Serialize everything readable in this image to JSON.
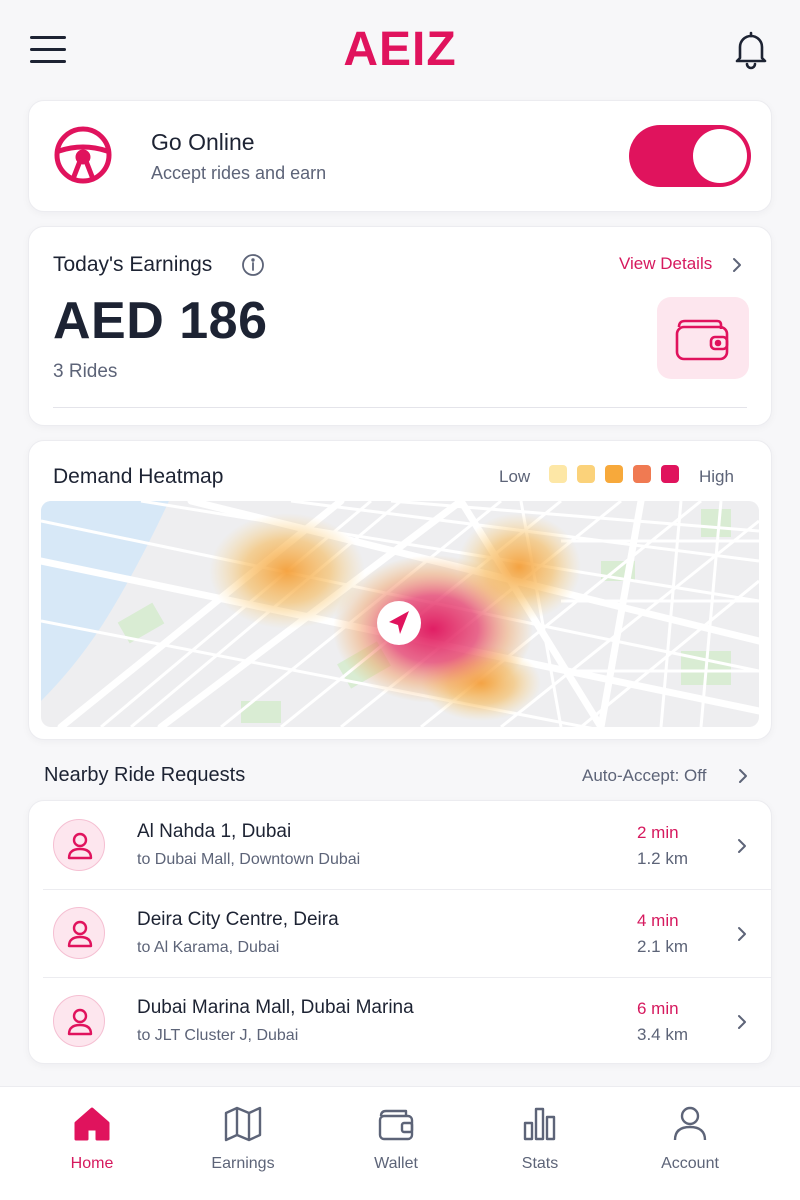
{
  "app": {
    "logo": "AEIZ",
    "accent_color": "#e0135d",
    "menu_icon": "hamburger-menu-icon",
    "notification_icon": "bell-icon"
  },
  "online": {
    "title": "Go Online",
    "subtitle": "Accept rides and earn",
    "icon": "steering-wheel-icon",
    "toggle_on": true
  },
  "earnings": {
    "title": "Today's Earnings",
    "view_details": "View Details",
    "amount": "AED 186",
    "rides": "3 Rides",
    "icon": "wallet-icon"
  },
  "heatmap": {
    "title": "Demand Heatmap",
    "legend_low": "Low",
    "legend_high": "High",
    "legend_colors": [
      "#fde7a6",
      "#fbd27a",
      "#f7a93b",
      "#f07a52",
      "#e0135d"
    ]
  },
  "requests": {
    "title": "Nearby Ride Requests",
    "auto_accept": "Auto-Accept: Off",
    "items": [
      {
        "from": "Al Nahda 1, Dubai",
        "to": "to Dubai Mall, Downtown Dubai",
        "eta": "2 min",
        "distance": "1.2 km"
      },
      {
        "from": "Deira City Centre, Deira",
        "to": "to Al Karama, Dubai",
        "eta": "4 min",
        "distance": "2.1 km"
      },
      {
        "from": "Dubai Marina Mall, Dubai Marina",
        "to": "to JLT Cluster J, Dubai",
        "eta": "6 min",
        "distance": "3.4 km"
      }
    ]
  },
  "nav": {
    "items": [
      {
        "label": "Home",
        "icon": "home-icon",
        "active": true
      },
      {
        "label": "Earnings",
        "icon": "map-icon",
        "active": false
      },
      {
        "label": "Wallet",
        "icon": "wallet-icon",
        "active": false
      },
      {
        "label": "Stats",
        "icon": "bar-chart-icon",
        "active": false
      },
      {
        "label": "Account",
        "icon": "user-icon",
        "active": false
      }
    ]
  }
}
